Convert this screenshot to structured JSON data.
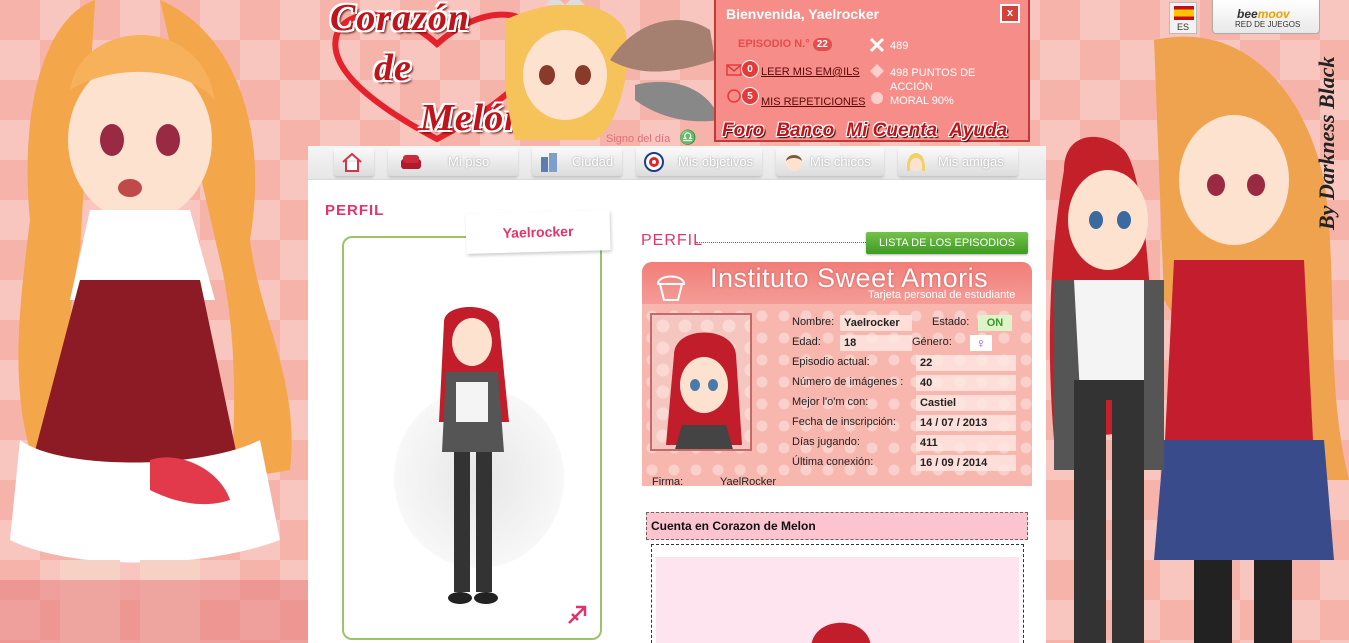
{
  "logo": {
    "line1": "Corazón",
    "line2": "de",
    "line3": "Melón"
  },
  "welcome": {
    "title": "Bienvenida, Yaelrocker",
    "close_label": "x",
    "episode_label": "EPISODIO N.°",
    "episode_number": "22",
    "emails_badge": "0",
    "emails_link": "LEER MIS EM@ILS",
    "repetitions_badge": "5",
    "repetitions_link": "MIS REPETICIONES",
    "dollars": "489",
    "action_points_line1": "498 PUNTOS DE",
    "action_points_line2": "ACCIÓN",
    "morale": "MORAL 90%"
  },
  "language": {
    "code": "ES"
  },
  "beemoov": {
    "brand_main": "bee",
    "brand_accent": "moov",
    "tagline": "RED DE JUEGOS"
  },
  "signo": {
    "label": "Signo del día"
  },
  "topnav": [
    "Foro",
    "Banco",
    "Mi Cuenta",
    "Ayuda"
  ],
  "watermark": "By Darkness Black",
  "tabs": [
    {
      "label": "",
      "icon": "home-icon"
    },
    {
      "label": "Mi piso",
      "icon": "sofa-icon"
    },
    {
      "label": "Ciudad",
      "icon": "city-icon"
    },
    {
      "label": "Mis objetivos",
      "icon": "target-icon"
    },
    {
      "label": "Mis chicos",
      "icon": "boy-face-icon"
    },
    {
      "label": "Mis amigas",
      "icon": "girl-face-icon"
    }
  ],
  "profile": {
    "heading": "PERFIL",
    "username_tag": "Yaelrocker",
    "right_heading": "PERFIL",
    "episodes_button": "LISTA DE LOS EPISODIOS"
  },
  "student_card": {
    "title": "Instituto Sweet Amoris",
    "subtitle": "Tarjeta personal de estudiante",
    "name_label": "Nombre:",
    "name_value": "Yaelrocker",
    "status_label": "Estado:",
    "status_value": "ON",
    "age_label": "Edad:",
    "age_value": "18",
    "gender_label": "Género:",
    "gender_symbol": "♀",
    "episode_label": "Episodio actual:",
    "episode_value": "22",
    "images_label": "Número de imágenes :",
    "images_value": "40",
    "best_label": "Mejor l'o'm con:",
    "best_value": "Castiel",
    "signup_label": "Fecha de inscripción:",
    "signup_value": "14 / 07 / 2013",
    "days_label": "Días jugando:",
    "days_value": "411",
    "last_label": "Última conexión:",
    "last_value": "16 / 09 / 2014",
    "signature_label": "Firma:",
    "signature_value": "YaelRocker"
  },
  "account": {
    "title": "Cuenta en Corazon de Melon"
  },
  "colors": {
    "accent_pink": "#e6336b",
    "brand_red": "#c0141b",
    "green": "#4aa82a"
  }
}
